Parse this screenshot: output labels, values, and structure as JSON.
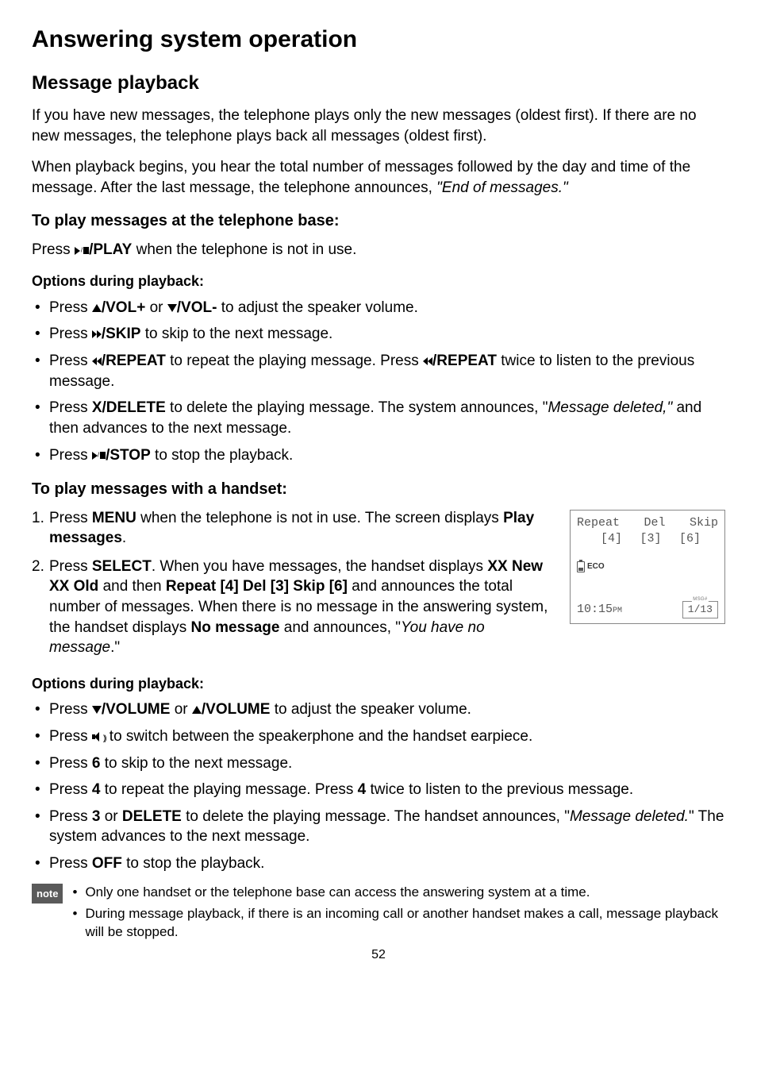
{
  "title": "Answering system operation",
  "section": "Message playback",
  "intro1": "If you have new messages, the telephone plays only the new messages (oldest first). If there are no new messages, the telephone plays back all messages (oldest first).",
  "intro2_a": "When playback begins, you hear the total number of messages followed by the day and time of the message. After the last message, the telephone announces, ",
  "intro2_b": "\"End of messages.\"",
  "base_heading": "To play messages at the telephone base:",
  "base_press_a": "Press ",
  "base_press_b": "/PLAY",
  "base_press_c": " when the telephone is not in use.",
  "options_heading": "Options during playback:",
  "base_opts": {
    "vol_a": "Press ",
    "vol_b": "/VOL+",
    "vol_c": " or ",
    "vol_d": "/VOL-",
    "vol_e": " to adjust the speaker volume.",
    "skip_a": "Press ",
    "skip_b": "/SKIP",
    "skip_c": " to skip to the next message.",
    "rep_a": "Press ",
    "rep_b": "/REPEAT",
    "rep_c": " to repeat the playing message. Press ",
    "rep_d": "/REPEAT",
    "rep_e": " twice to listen to the previous message.",
    "del_a": "Press ",
    "del_b": "X/DELETE",
    "del_c": " to delete the playing message. The system announces, \"",
    "del_d": "Message deleted,\"",
    "del_e": " and then advances to the next message.",
    "stop_a": "Press ",
    "stop_b": "/STOP",
    "stop_c": " to stop the playback."
  },
  "handset_heading": "To play messages with a handset:",
  "steps": {
    "s1_a": "Press ",
    "s1_b": "MENU",
    "s1_c": " when the telephone is not in use. The screen displays ",
    "s1_d": "Play messages",
    "s1_e": ".",
    "s2_a": "Press ",
    "s2_b": "SELECT",
    "s2_c": ". When you have messages, the handset displays ",
    "s2_d": "XX New XX Old",
    "s2_e": " and then ",
    "s2_f": "Repeat [4] Del [3] Skip [6]",
    "s2_g": " and announces the total number of messages. When there is no message in the answering system, the handset displays ",
    "s2_h": "No message",
    "s2_i": " and announces, \"",
    "s2_j": "You have no message",
    "s2_k": ".\""
  },
  "lcd": {
    "repeat": "Repeat",
    "del": "Del",
    "skip": "Skip",
    "k4": "[4]",
    "k3": "[3]",
    "k6": "[6]",
    "eco": "ECO",
    "time_a": "10:15",
    "time_b": "PM",
    "count": "1/13"
  },
  "handset_opts": {
    "vol_a": "Press ",
    "vol_b": "/VOLUME",
    "vol_c": " or ",
    "vol_d": "/VOLUME",
    "vol_e": " to adjust the speaker volume.",
    "spk_a": "Press ",
    "spk_b": " to switch between the speakerphone and the handset earpiece.",
    "six_a": "Press ",
    "six_b": "6",
    "six_c": " to skip to the next message.",
    "four_a": "Press ",
    "four_b": "4",
    "four_c": " to repeat the playing message. Press ",
    "four_d": "4",
    "four_e": " twice to listen to the previous message.",
    "three_a": "Press ",
    "three_b": "3",
    "three_c": " or ",
    "three_d": "DELETE",
    "three_e": " to delete the playing message. The handset announces, \"",
    "three_f": "Message deleted.",
    "three_g": "\" The system advances to the next message.",
    "off_a": "Press ",
    "off_b": "OFF",
    "off_c": " to stop the playback."
  },
  "note_label": "note",
  "notes": {
    "n1": "Only one handset or the telephone base can access the answering system at a time.",
    "n2": "During message playback, if there is an incoming call or another handset makes a call, message playback will be stopped."
  },
  "page": "52"
}
